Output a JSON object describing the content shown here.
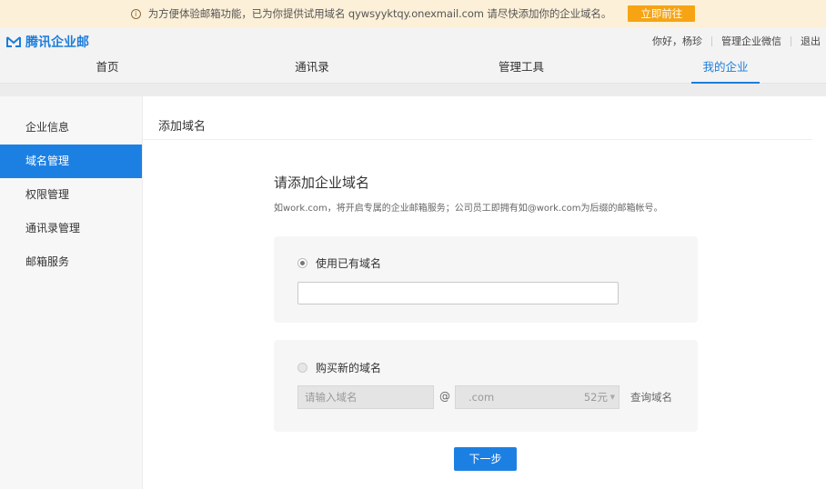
{
  "notice": {
    "icon": "info-circle-icon",
    "text": "为方便体验邮箱功能，已为你提供试用域名 qywsyyktqy.onexmail.com 请尽快添加你的企业域名。",
    "button": "立即前往"
  },
  "header": {
    "brand": "腾讯企业邮",
    "greeting": "你好，杨珍",
    "manage_wechat": "管理企业微信",
    "logout": "退出"
  },
  "nav": {
    "tabs": [
      {
        "label": "首页"
      },
      {
        "label": "通讯录"
      },
      {
        "label": "管理工具"
      },
      {
        "label": "我的企业"
      }
    ],
    "active": "我的企业"
  },
  "sidebar": {
    "items": [
      {
        "label": "企业信息"
      },
      {
        "label": "域名管理"
      },
      {
        "label": "权限管理"
      },
      {
        "label": "通讯录管理"
      },
      {
        "label": "邮箱服务"
      }
    ],
    "active": "域名管理"
  },
  "main": {
    "page_title": "添加域名",
    "heading": "请添加企业域名",
    "description": "如work.com，将开启专属的企业邮箱服务；公司员工即拥有如@work.com为后缀的邮箱帐号。",
    "option_existing": {
      "label": "使用已有域名",
      "selected": true,
      "value": ""
    },
    "option_buy": {
      "label": "购买新的域名",
      "selected": false,
      "input_placeholder": "请输入域名",
      "at": "@",
      "tld": ".com",
      "price": "52元",
      "query": "查询域名"
    },
    "next_button": "下一步"
  },
  "colors": {
    "accent": "#1c80e3",
    "notice_bg": "#fdf0d8",
    "notice_button": "#f6a414"
  }
}
